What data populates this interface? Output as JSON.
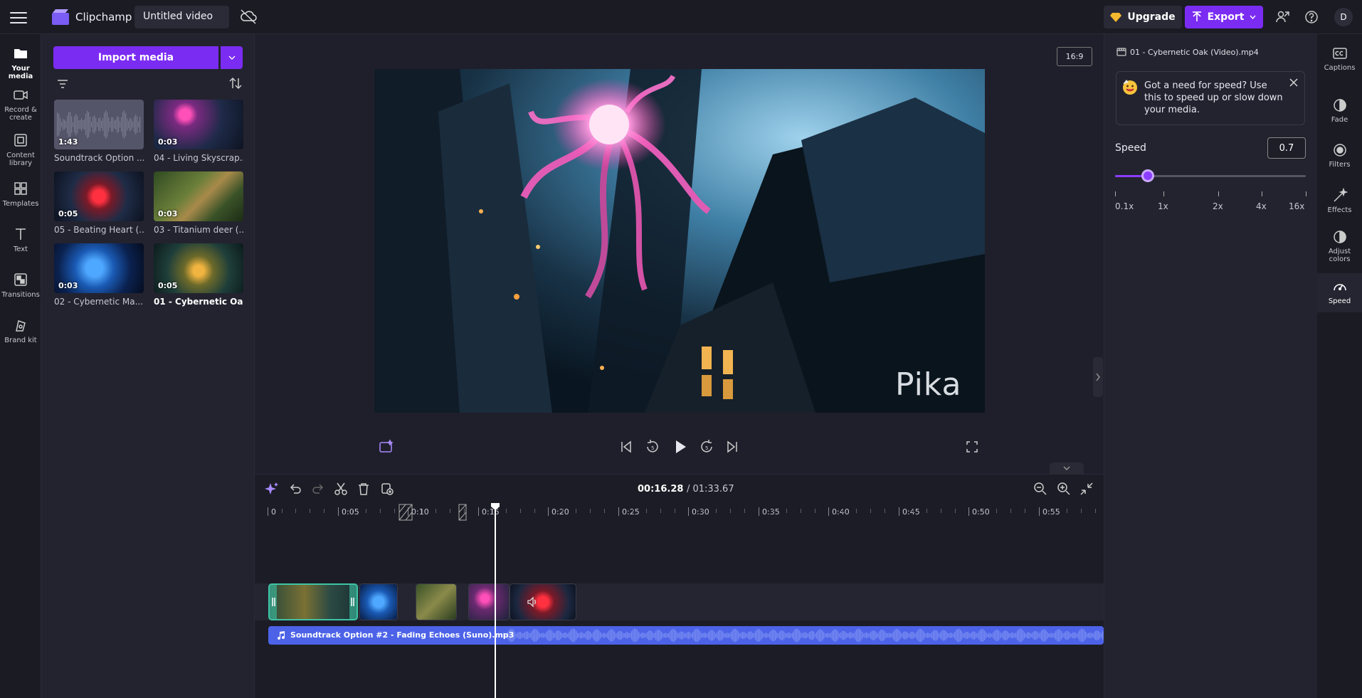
{
  "app": {
    "name": "Clipchamp",
    "project_title": "Untitled video"
  },
  "topbar": {
    "upgrade_label": "Upgrade",
    "export_label": "Export",
    "avatar_initial": "D"
  },
  "leftnav": [
    {
      "label": "Your media",
      "active": true
    },
    {
      "label": "Record & create"
    },
    {
      "label": "Content library"
    },
    {
      "label": "Templates"
    },
    {
      "label": "Text"
    },
    {
      "label": "Transitions"
    },
    {
      "label": "Brand kit"
    }
  ],
  "media_panel": {
    "import_label": "Import media",
    "items": [
      {
        "name": "Soundtrack Option ...",
        "duration": "1:43"
      },
      {
        "name": "04 - Living Skyscrap...",
        "duration": "0:03"
      },
      {
        "name": "05 - Beating Heart (...",
        "duration": "0:05"
      },
      {
        "name": "03 - Titanium deer (...",
        "duration": "0:03"
      },
      {
        "name": "02 - Cybernetic Ma...",
        "duration": "0:03"
      },
      {
        "name": "01 - Cybernetic Oa...",
        "duration": "0:05",
        "selected": true
      }
    ],
    "check": "✓"
  },
  "preview": {
    "aspect_ratio": "16:9",
    "watermark": "Pika"
  },
  "timeline": {
    "current_time": "00:16.28",
    "total_time": "/ 01:33.67",
    "ticks": [
      "0",
      "0:05",
      "0:10",
      "0:15",
      "0:20",
      "0:25",
      "0:30",
      "0:35",
      "0:40",
      "0:45",
      "0:50",
      "0:55"
    ],
    "audio_clip_name": "Soundtrack Option #2 - Fading Echoes (Suno).mp3"
  },
  "right_panel": {
    "clip_name": "01 - Cybernetic Oak (Video).mp4",
    "tip_text": "Got a need for speed? Use this to speed up or slow down your media.",
    "speed_label": "Speed",
    "speed_value": "0.7",
    "speed_fraction": 0.17,
    "speed_ticks": [
      "0.1x",
      "1x",
      "2x",
      "4x",
      "16x"
    ]
  },
  "righttabs": [
    {
      "label": "Captions"
    },
    {
      "label": "Fade"
    },
    {
      "label": "Filters"
    },
    {
      "label": "Effects"
    },
    {
      "label": "Adjust colors"
    },
    {
      "label": "Speed",
      "active": true
    }
  ],
  "colors": {
    "accent": "#7b2cf2",
    "audio": "#4c63e8",
    "selected_clip": "#3ec4a5"
  }
}
